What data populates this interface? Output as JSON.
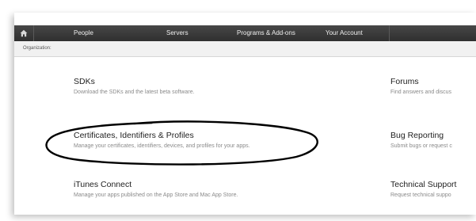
{
  "topbar": {
    "home_icon": "home-icon",
    "nav": [
      "People",
      "Servers",
      "Programs & Add-ons",
      "Your Account"
    ]
  },
  "org_bar": {
    "label": "Organization:"
  },
  "left_column": [
    {
      "title": "SDKs",
      "description": "Download the SDKs and the latest beta software."
    },
    {
      "title": "Certificates, Identifiers & Profiles",
      "description": "Manage your certificates, identifiers, devices, and profiles for your apps."
    },
    {
      "title": "iTunes Connect",
      "description": "Manage your apps published on the App Store and Mac App Store."
    }
  ],
  "right_column": [
    {
      "title": "Forums",
      "description": "Find answers and discus"
    },
    {
      "title": "Bug Reporting",
      "description": "Submit bugs or request c"
    },
    {
      "title": "Technical Support",
      "description": "Request technical suppo"
    }
  ],
  "annotation": {
    "shape": "hand-drawn-ellipse",
    "color": "#000000"
  }
}
